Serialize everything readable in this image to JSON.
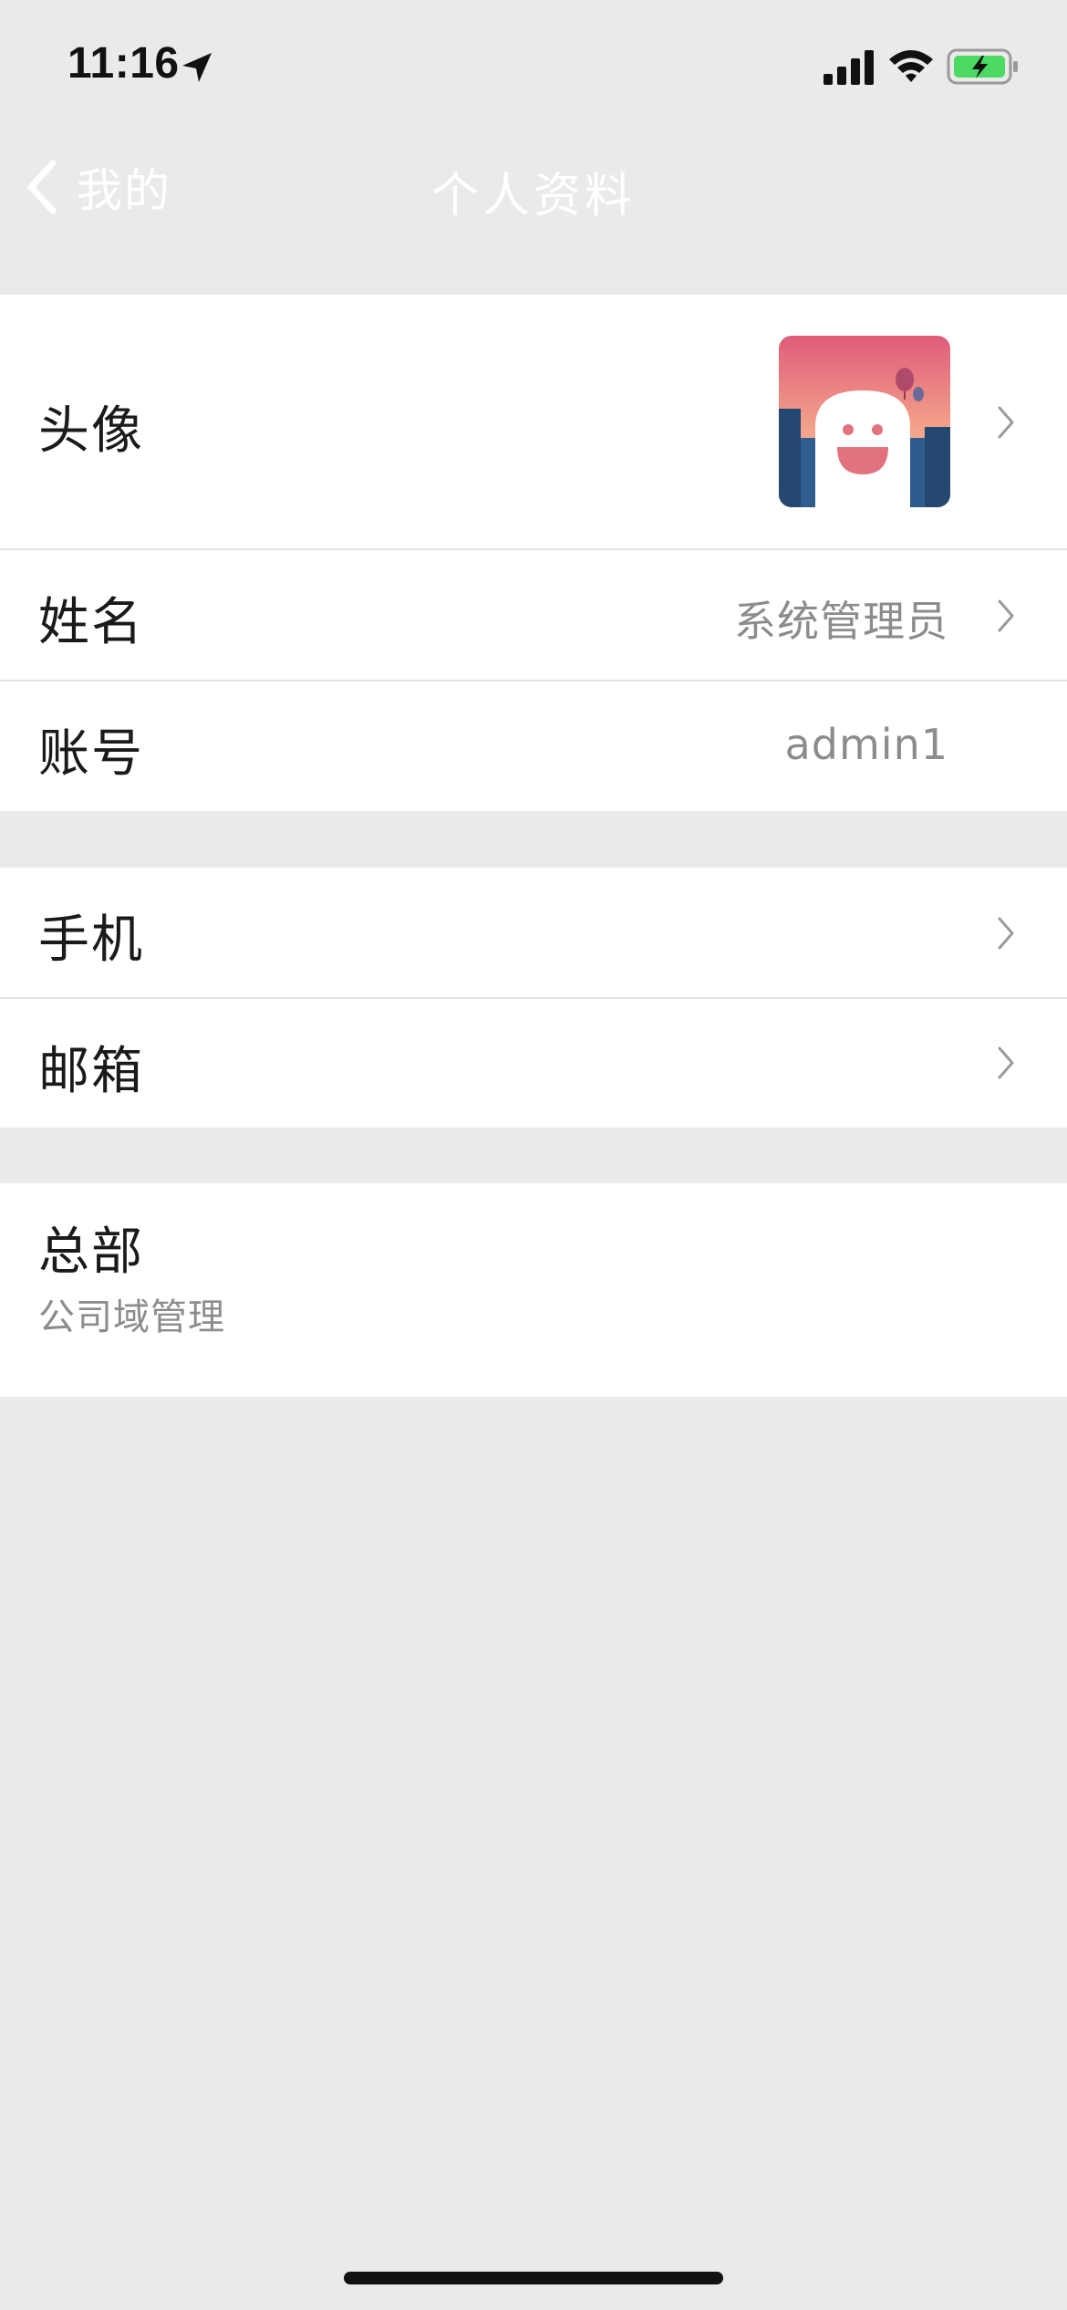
{
  "status_bar": {
    "time": "11:16",
    "icons": [
      "location-arrow-icon",
      "cellular-signal-icon",
      "wifi-icon",
      "battery-charging-icon"
    ],
    "battery_color": "#4CD964"
  },
  "nav": {
    "back_label": "我的",
    "title": "个人资料",
    "title_color": "#FFFFFF"
  },
  "profile": {
    "avatar_label": "头像",
    "name_label": "姓名",
    "name_value": "系统管理员",
    "account_label": "账号",
    "account_value": "admin1"
  },
  "contact": {
    "phone_label": "手机",
    "email_label": "邮箱"
  },
  "org": {
    "name": "总部",
    "role": "公司域管理"
  },
  "colors": {
    "background": "#EAEAEA",
    "card": "#FFFFFF",
    "secondary_text": "#8C8C8C",
    "primary_text": "#1A1A1A"
  }
}
